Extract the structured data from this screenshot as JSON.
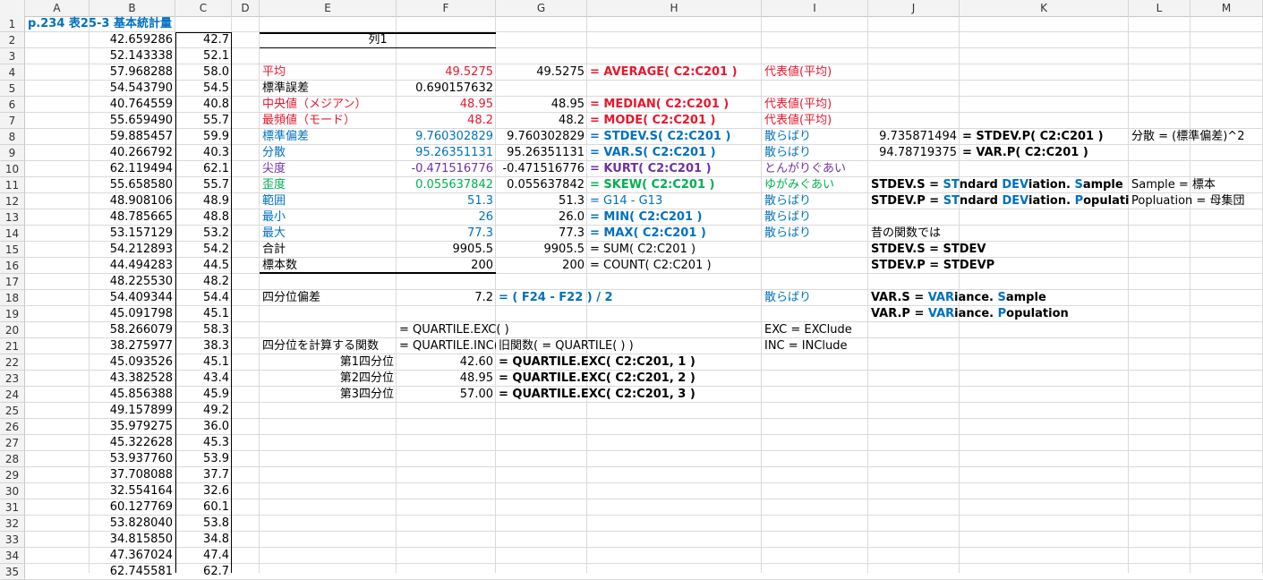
{
  "columns": [
    "A",
    "B",
    "C",
    "D",
    "E",
    "F",
    "G",
    "H",
    "I",
    "J",
    "K",
    "L",
    "M"
  ],
  "rows": [
    "1",
    "2",
    "3",
    "4",
    "5",
    "6",
    "7",
    "8",
    "9",
    "10",
    "11",
    "12",
    "13",
    "14",
    "15",
    "16",
    "17",
    "18",
    "19",
    "20",
    "21",
    "22",
    "23",
    "24",
    "25",
    "26",
    "27",
    "28",
    "29",
    "30",
    "31",
    "32",
    "33",
    "34",
    "35"
  ],
  "colors": {
    "red": "#e8172c",
    "blue": "#0070c0",
    "purple": "#7030a0",
    "green": "#00b050",
    "title": "#0070c0"
  },
  "title": "p.234 表25-3 基本統計量",
  "colB": [
    "42.659286",
    "52.143338",
    "57.968288",
    "54.543790",
    "40.764559",
    "55.659490",
    "59.885457",
    "40.266792",
    "62.119494",
    "55.658580",
    "48.908106",
    "48.785665",
    "53.157129",
    "54.212893",
    "44.494283",
    "48.225530",
    "54.409344",
    "45.091798",
    "58.266079",
    "38.275977",
    "45.093526",
    "43.382528",
    "45.856388",
    "49.157899",
    "35.979275",
    "45.322628",
    "53.937760",
    "37.708088",
    "32.554164",
    "60.127769",
    "53.828040",
    "34.815850",
    "47.367024",
    "62.745581"
  ],
  "colC": [
    "42.7",
    "52.1",
    "58.0",
    "54.5",
    "40.8",
    "55.7",
    "59.9",
    "40.3",
    "62.1",
    "55.7",
    "48.9",
    "48.8",
    "53.2",
    "54.2",
    "44.5",
    "48.2",
    "54.4",
    "45.1",
    "58.3",
    "38.3",
    "45.1",
    "43.4",
    "45.9",
    "49.2",
    "36.0",
    "45.3",
    "53.9",
    "37.7",
    "32.6",
    "60.1",
    "53.8",
    "34.8",
    "47.4",
    "62.7"
  ],
  "table_header": "列1",
  "stats": [
    {
      "label": "平均",
      "f": "49.5275",
      "g": "49.5275",
      "h": "= AVERAGE( C2:C201 )",
      "i": "代表値(平均)",
      "color": "red"
    },
    {
      "label": "標準誤差",
      "f": "0.690157632",
      "g": "",
      "h": "",
      "i": "",
      "color": "black"
    },
    {
      "label": "中央値（メジアン）",
      "f": "48.95",
      "g": "48.95",
      "h": "= MEDIAN( C2:C201 )",
      "i": "代表値(平均)",
      "color": "red"
    },
    {
      "label": "最頻値（モード）",
      "f": "48.2",
      "g": "48.2",
      "h": "= MODE( C2:C201 )",
      "i": "代表値(平均)",
      "color": "red"
    },
    {
      "label": "標準偏差",
      "f": "9.760302829",
      "g": "9.760302829",
      "h": "= STDEV.S( C2:C201 )",
      "i": "散らばり",
      "color": "blue"
    },
    {
      "label": "分散",
      "f": "95.26351131",
      "g": "95.26351131",
      "h": "= VAR.S( C2:C201 )",
      "i": "散らばり",
      "color": "blue"
    },
    {
      "label": "尖度",
      "f": "-0.471516776",
      "g": "-0.471516776",
      "h": "= KURT( C2:C201 )",
      "i": "とんがりぐあい",
      "color": "purple"
    },
    {
      "label": "歪度",
      "f": "0.055637842",
      "g": "0.055637842",
      "h": "= SKEW( C2:C201 )",
      "i": "ゆがみぐあい",
      "color": "green"
    },
    {
      "label": "範囲",
      "f": "51.3",
      "g": "51.3",
      "h": "= G14 - G13",
      "i": "散らばり",
      "color": "blue"
    },
    {
      "label": "最小",
      "f": "26",
      "g": "26.0",
      "h": "= MIN( C2:C201 )",
      "i": "散らばり",
      "color": "blue"
    },
    {
      "label": "最大",
      "f": "77.3",
      "g": "77.3",
      "h": "= MAX( C2:C201 )",
      "i": "散らばり",
      "color": "blue"
    },
    {
      "label": "合計",
      "f": "9905.5",
      "g": "9905.5",
      "h": "= SUM( C2:C201 )",
      "i": "",
      "color": "black"
    },
    {
      "label": "標本数",
      "f": "200",
      "g": "200",
      "h": "= COUNT( C2:C201 )",
      "i": "",
      "color": "black"
    }
  ],
  "stdev_p": {
    "j8": "9.735871494",
    "k8": "= STDEV.P( C2:C201 )",
    "l8": "分散 = (標準偏差)^2",
    "j9": "94.78719375",
    "k9": "= VAR.P( C2:C201 )"
  },
  "notes": {
    "r11_stdev_s_pre": "STDEV.S = ",
    "r11_st": "ST",
    "r11_ndard": "ndard ",
    "r11_dev": "DEV",
    "r11_iation": "iation. ",
    "r11_s": "S",
    "r11_ample": "ample",
    "l11": "Sample = 標本",
    "r12_stdev_p_pre": "STDEV.P = ",
    "r12_st": "ST",
    "r12_ndard": "ndard ",
    "r12_dev": "DEV",
    "r12_iation": "iation. ",
    "r12_p": "P",
    "r12_opulati": "opulati",
    "l12": "Popluation = 母集団",
    "j14": "昔の関数では",
    "j15": "STDEV.S = STDEV",
    "j16": "STDEV.P = STDEVP",
    "j18_pre": "VAR.S = ",
    "j18_var": "VAR",
    "j18_iance": "iance. ",
    "j18_s": "S",
    "j18_ample": "ample",
    "j19_pre": "VAR.P = ",
    "j19_var": "VAR",
    "j19_iance": "iance. ",
    "j19_p": "P",
    "j19_opulation": "opulation"
  },
  "quartile_dev": {
    "label": "四分位偏差",
    "f": "7.2",
    "g": "= ( F24 - F22 ) / 2",
    "i": "散らばり"
  },
  "quartile": {
    "f20": "= QUARTILE.EXC( )",
    "i20": "EXC = EXClude",
    "e21": "四分位を計算する関数",
    "f21": "= QUARTILE.INC( )",
    "g21": "旧関数( = QUARTILE( ) )",
    "i21": "INC = INClude",
    "rows": [
      {
        "label": "第1四分位",
        "value": "42.60",
        "formula": "= QUARTILE.EXC( C2:C201, 1 )"
      },
      {
        "label": "第2四分位",
        "value": "48.95",
        "formula": "= QUARTILE.EXC( C2:C201, 2 )"
      },
      {
        "label": "第3四分位",
        "value": "57.00",
        "formula": "= QUARTILE.EXC( C2:C201, 3 )"
      }
    ]
  }
}
